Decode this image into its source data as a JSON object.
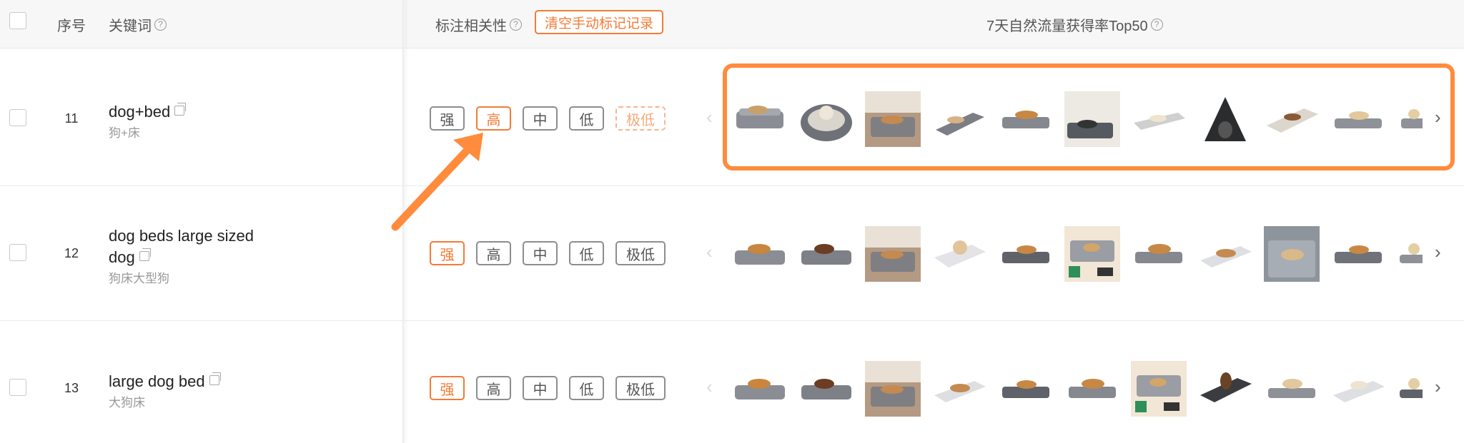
{
  "header": {
    "index_label": "序号",
    "keyword_label": "关键词",
    "relevance_label": "标注相关性",
    "clear_button": "清空手动标记记录",
    "top_label": "7天自然流量获得率Top50",
    "help_glyph": "?"
  },
  "nav": {
    "prev": "‹",
    "next": "›"
  },
  "rows": [
    {
      "index": "11",
      "keyword_line1": "dog+bed",
      "keyword_line2": "",
      "subtitle": "狗+床",
      "tags": [
        "强",
        "高",
        "中",
        "低",
        "极低"
      ],
      "active_tag": "高"
    },
    {
      "index": "12",
      "keyword_line1": "dog beds large sized",
      "keyword_line2": "dog",
      "subtitle": "狗床大型狗",
      "tags": [
        "强",
        "高",
        "中",
        "低",
        "极低"
      ],
      "active_tag": "强"
    },
    {
      "index": "13",
      "keyword_line1": "large dog bed",
      "keyword_line2": "",
      "subtitle": "大狗床",
      "tags": [
        "强",
        "高",
        "中",
        "低",
        "极低"
      ],
      "active_tag": "强"
    }
  ],
  "colors": {
    "accent": "#f47b36",
    "highlight": "#ff8b3d",
    "header_bg": "#f7f7f7"
  }
}
